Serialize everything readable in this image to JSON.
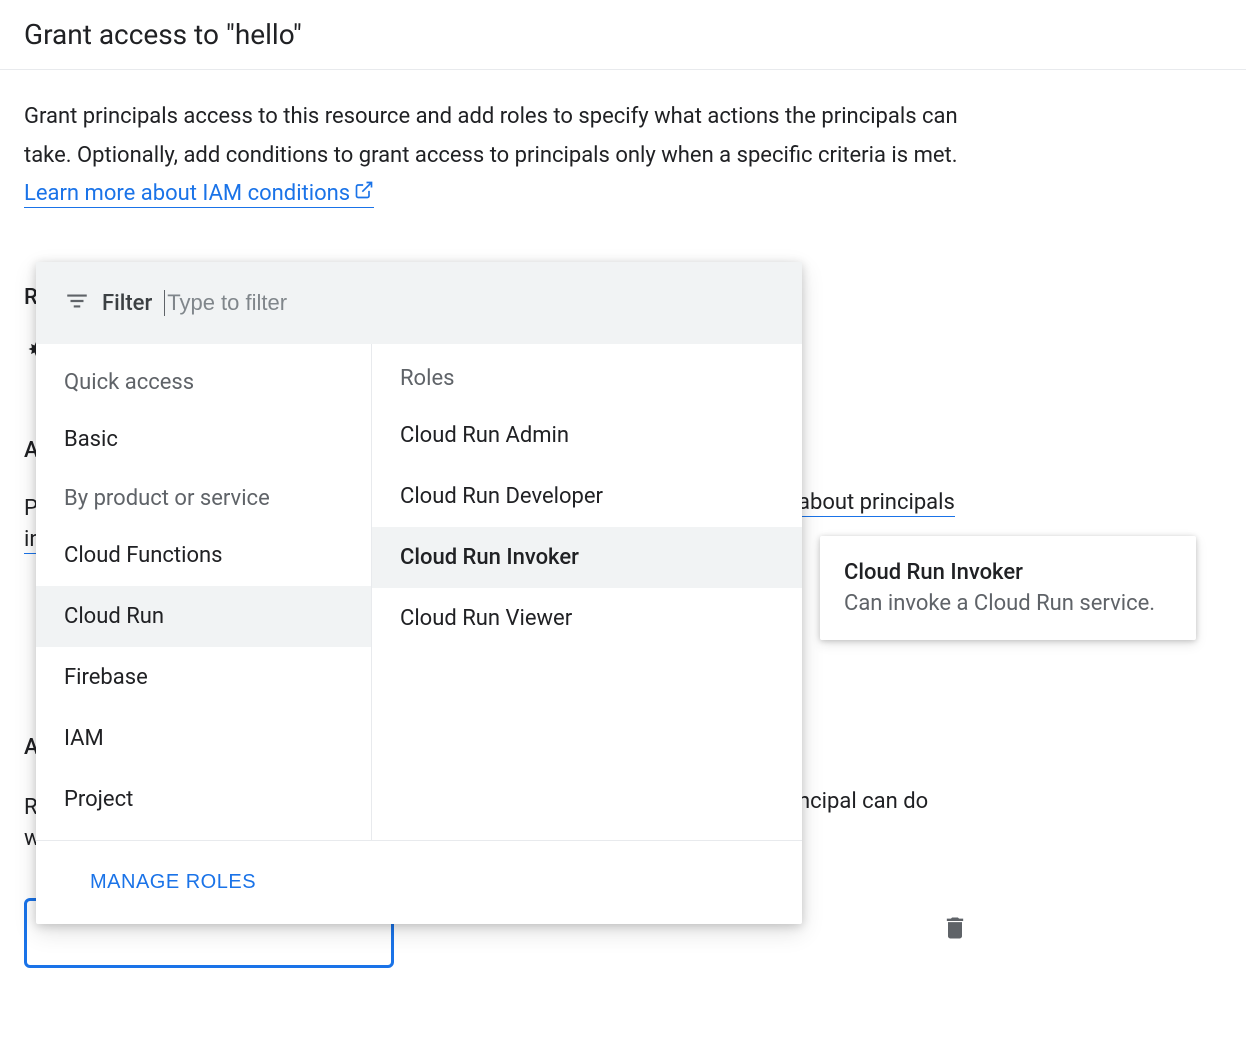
{
  "header": {
    "title": "Grant access to \"hello\""
  },
  "description": {
    "text": "Grant principals access to this resource and add roles to specify what actions the principals can take. Optionally, add conditions to grant access to principals only when a specific criteria is met. ",
    "link_text": "Learn more about IAM conditions"
  },
  "background": {
    "r_label": "R",
    "a1_label": "A",
    "pi_label": "Pi",
    "in_label": "in",
    "about_principals": "about principals",
    "a2_label": "A",
    "r2_label": "R",
    "w_label": "w",
    "principal_can_do": "ncipal can do"
  },
  "filter": {
    "label": "Filter",
    "placeholder": "Type to filter"
  },
  "picker": {
    "quick_access_label": "Quick access",
    "by_product_label": "By product or service",
    "categories": {
      "basic": "Basic",
      "cloud_functions": "Cloud Functions",
      "cloud_run": "Cloud Run",
      "firebase": "Firebase",
      "iam": "IAM",
      "project": "Project"
    },
    "roles_label": "Roles",
    "roles": {
      "admin": "Cloud Run Admin",
      "developer": "Cloud Run Developer",
      "invoker": "Cloud Run Invoker",
      "viewer": "Cloud Run Viewer"
    },
    "manage_roles": "MANAGE ROLES"
  },
  "tooltip": {
    "title": "Cloud Run Invoker",
    "description": "Can invoke a Cloud Run service."
  }
}
